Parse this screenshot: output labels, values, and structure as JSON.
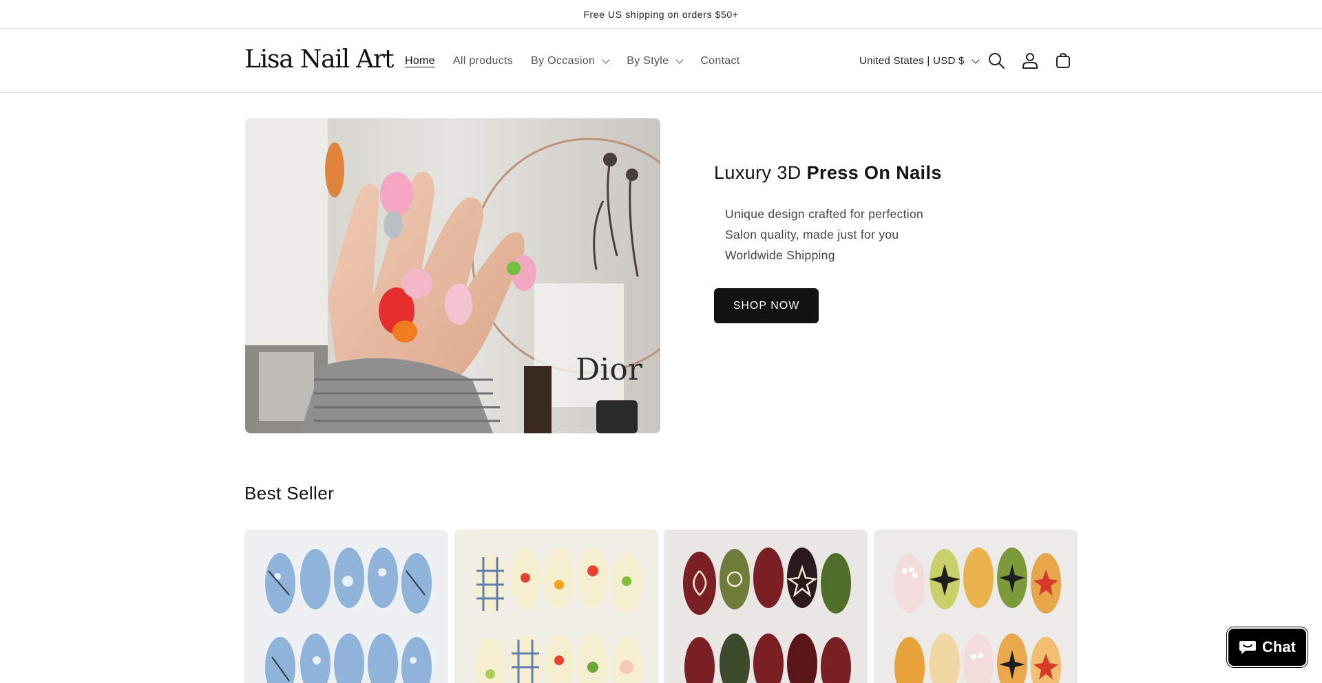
{
  "announcement": {
    "text": "Free US shipping on orders $50+"
  },
  "header": {
    "logo": "Lisa Nail Art",
    "nav": [
      {
        "label": "Home",
        "active": true
      },
      {
        "label": "All products"
      },
      {
        "label": "By Occasion",
        "dropdown": true
      },
      {
        "label": "By Style",
        "dropdown": true
      },
      {
        "label": "Contact"
      }
    ],
    "country": "United States | USD $",
    "icons": [
      "search-icon",
      "account-icon",
      "cart-icon"
    ]
  },
  "hero": {
    "title_light": "Luxury 3D ",
    "title_bold": "Press On Nails",
    "lines": [
      "Unique design crafted for perfection",
      "Salon quality, made just for you",
      "Worldwide Shipping"
    ],
    "button": "SHOP NOW",
    "image_text": "Dior"
  },
  "best_seller": {
    "title": "Best Seller"
  },
  "chat": {
    "label": "Chat"
  },
  "colors": {
    "accent": "#121212",
    "chat_bg": "#000000"
  }
}
